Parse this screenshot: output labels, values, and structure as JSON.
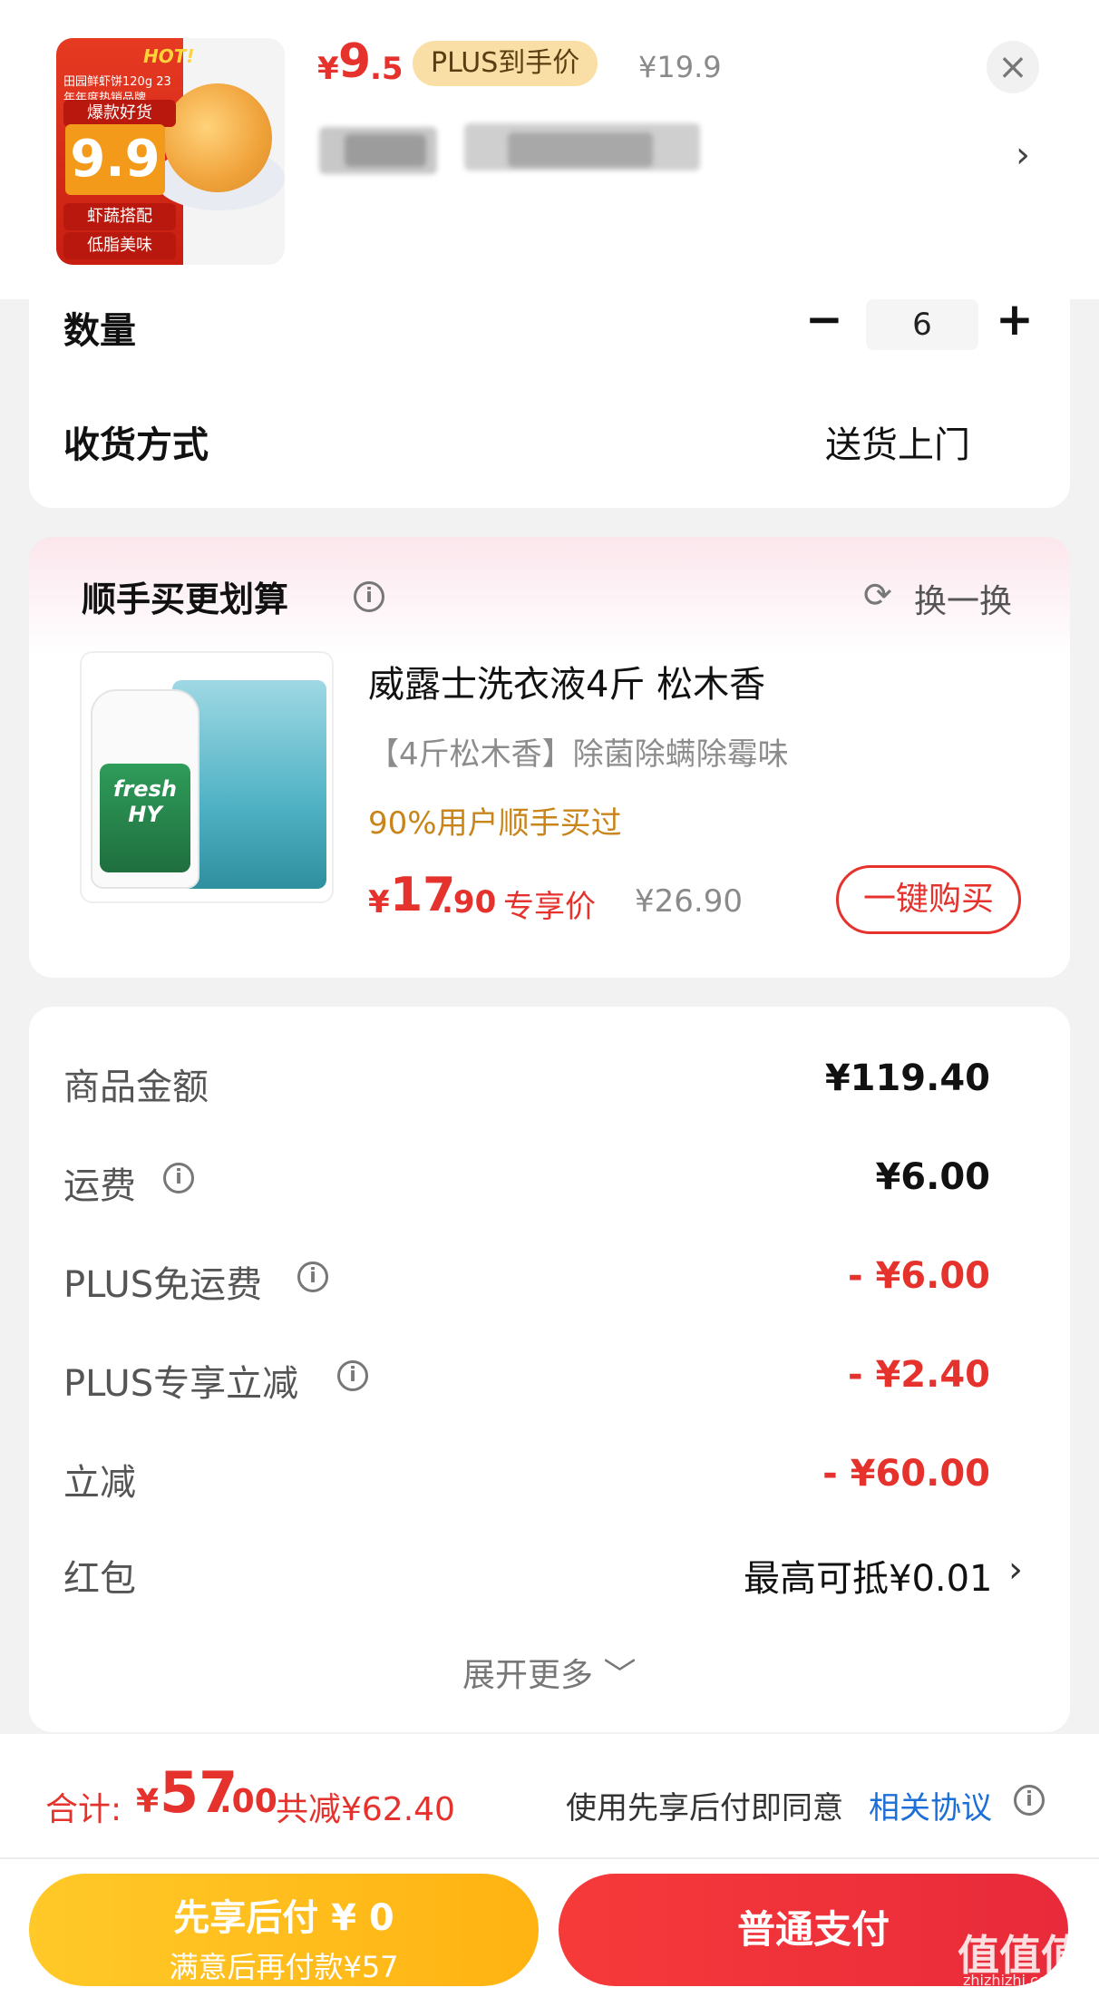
{
  "header": {
    "thumb": {
      "hot": "HOT!",
      "title": "田园鲜虾饼120g 23年年度热销品牌",
      "hit_badge": "爆款好货",
      "big_price": "9.9",
      "tag1": "虾蔬搭配",
      "tag2": "低脂美味"
    },
    "price_symbol": "¥",
    "price_int": "9",
    "price_dec": ".5",
    "plus_badge": "PLUS到手价",
    "original_price": "¥19.9",
    "close_icon": "×",
    "chevron": "›"
  },
  "order": {
    "quantity_label": "数量",
    "quantity_minus": "−",
    "quantity_value": "6",
    "quantity_plus": "+",
    "delivery_label": "收货方式",
    "delivery_value": "送货上门"
  },
  "recommend": {
    "title": "顺手买更划算",
    "refresh_label": "换一换",
    "product": {
      "name": "威露士洗衣液4斤 松木香",
      "subtitle": "【4斤松木香】除菌除螨除霉味",
      "social_proof": "90%用户顺手买过",
      "price_symbol": "¥",
      "price_int": "17",
      "price_dec": ".90",
      "price_tag": "专享价",
      "original_price": "¥26.90",
      "buy_button": "一键购买",
      "image_brand": "fresh HY"
    }
  },
  "fees": {
    "rows": [
      {
        "label": "商品金额",
        "value": "¥119.40",
        "info": false,
        "color": "dark"
      },
      {
        "label": "运费",
        "value": "¥6.00",
        "info": true,
        "color": "dark"
      },
      {
        "label": "PLUS免运费",
        "value": "- ¥6.00",
        "info": true,
        "color": "red"
      },
      {
        "label": "PLUS专享立减",
        "value": "- ¥2.40",
        "info": true,
        "color": "red"
      },
      {
        "label": "立减",
        "value": "- ¥60.00",
        "info": false,
        "color": "red"
      }
    ],
    "hongbao_label": "红包",
    "hongbao_value": "最高可抵¥0.01",
    "hongbao_chevron": "›",
    "expand_more": "展开更多 ﹀"
  },
  "footer": {
    "total_label": "合计:",
    "total_symbol": "¥",
    "total_int": "57",
    "total_dec": ".00",
    "total_saved": "共减¥62.40",
    "agree_text": "使用先享后付即同意",
    "agree_link": "相关协议",
    "pay_later_line1": "先享后付 ¥ 0",
    "pay_later_line2": "满意后再付款¥57",
    "pay_normal": "普通支付",
    "watermark": "值值值",
    "watermark_url": "zhizhizhi.com"
  },
  "colors": {
    "accent_red": "#e5322d",
    "gold": "#c9851a",
    "link_blue": "#1d6fd8",
    "later_yellow": "#ffbe1e"
  }
}
